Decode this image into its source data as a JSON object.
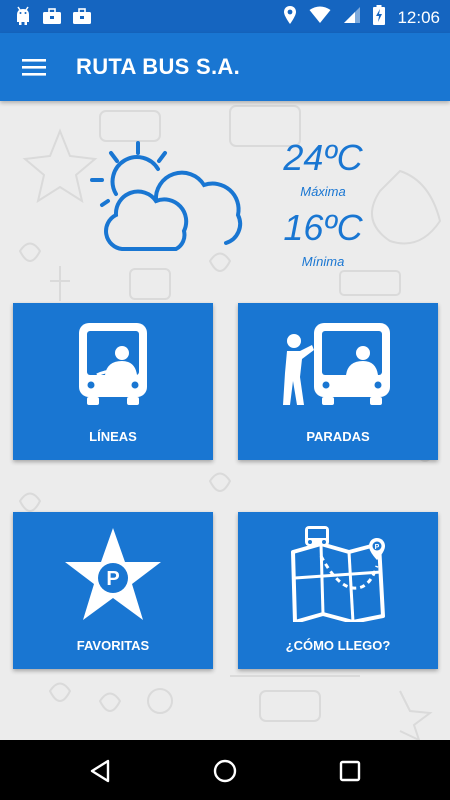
{
  "status_bar": {
    "time": "12:06",
    "left_icons": [
      "android-icon",
      "briefcase-icon",
      "briefcase-icon"
    ],
    "right_icons": [
      "location-icon",
      "wifi-icon",
      "signal-icon",
      "battery-charging-icon"
    ]
  },
  "app_bar": {
    "title": "RUTA BUS S.A.",
    "menu_icon": "hamburger-menu-icon"
  },
  "weather": {
    "icon": "sun-behind-clouds-icon",
    "max_temp": "24ºC",
    "max_label": "Máxima",
    "min_temp": "16ºC",
    "min_label": "Mínima"
  },
  "tiles": [
    {
      "label": "LÍNEAS",
      "icon": "bus-driver-icon"
    },
    {
      "label": "PARADAS",
      "icon": "bus-stop-passenger-icon"
    },
    {
      "label": "FAVORITAS",
      "icon": "star-parking-icon"
    },
    {
      "label": "¿CÓMO LLEGO?",
      "icon": "route-map-icon"
    }
  ],
  "nav_bar": {
    "buttons": [
      "back-icon",
      "home-icon",
      "recents-icon"
    ]
  },
  "colors": {
    "status_bar": "#1565c0",
    "primary": "#1976d2",
    "background": "#ececec",
    "nav_bar": "#000000"
  }
}
